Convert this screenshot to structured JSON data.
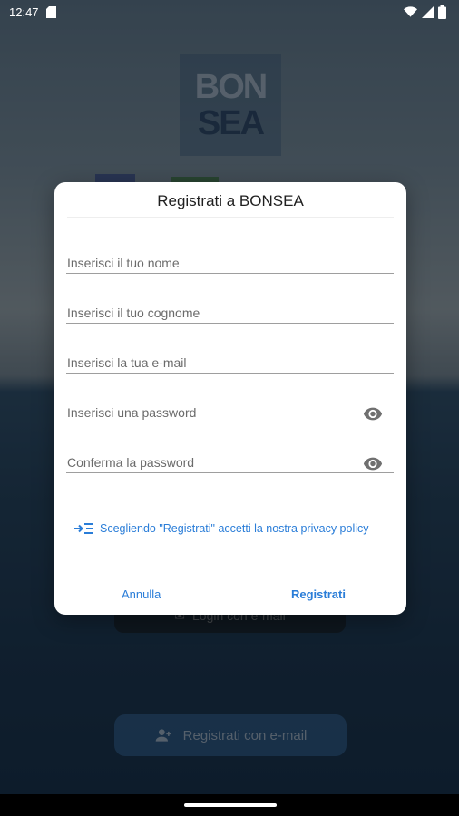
{
  "status_bar": {
    "time": "12:47",
    "icons": [
      "sd-card-icon",
      "wifi-icon",
      "signal-icon",
      "battery-icon"
    ]
  },
  "background": {
    "logo": {
      "line1": "BON",
      "line2": "SEA"
    },
    "login_button_label": "Login con e-mail",
    "register_button_label": "Registrati con e-mail"
  },
  "dialog": {
    "title": "Registrati a BONSEA",
    "fields": [
      {
        "placeholder": "Inserisci il tuo nome",
        "value": ""
      },
      {
        "placeholder": "Inserisci il tuo cognome",
        "value": ""
      },
      {
        "placeholder": "Inserisci la tua e-mail",
        "value": ""
      },
      {
        "placeholder": "Inserisci una password",
        "value": ""
      },
      {
        "placeholder": "Conferma la password",
        "value": ""
      }
    ],
    "privacy_text": "Scegliendo \"Registrati\" accetti la nostra privacy policy",
    "cancel_label": "Annulla",
    "register_label": "Registrati"
  },
  "colors": {
    "accent": "#2a7dd8",
    "field_line": "#9e9e9e",
    "placeholder": "#6b6b6b",
    "register_button_bg": "#2e5a86"
  }
}
